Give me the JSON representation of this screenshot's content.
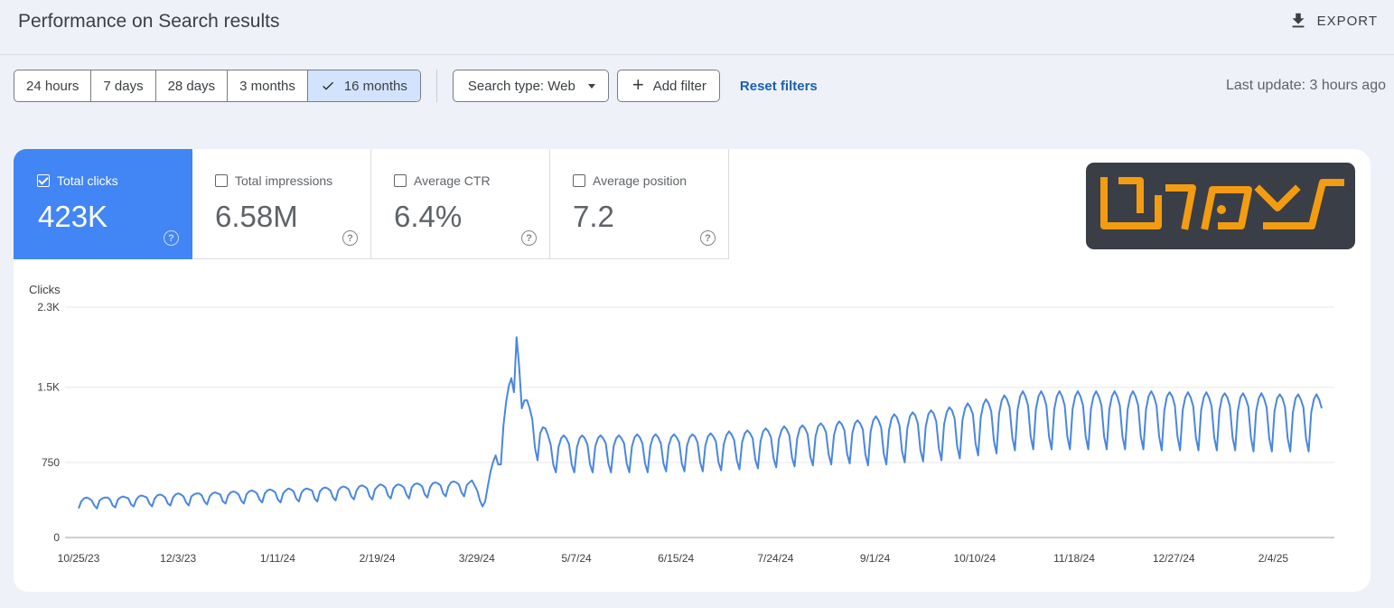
{
  "header": {
    "title": "Performance on Search results",
    "export_label": "EXPORT"
  },
  "toolbar": {
    "ranges": [
      {
        "label": "24 hours",
        "selected": false
      },
      {
        "label": "7 days",
        "selected": false
      },
      {
        "label": "28 days",
        "selected": false
      },
      {
        "label": "3 months",
        "selected": false
      },
      {
        "label": "16 months",
        "selected": true
      }
    ],
    "search_type": "Search type: Web",
    "add_filter": "Add filter",
    "reset": "Reset filters",
    "last_update": "Last update: 3 hours ago"
  },
  "metrics": [
    {
      "label": "Total clicks",
      "value": "423K",
      "checked": true
    },
    {
      "label": "Total impressions",
      "value": "6.58M",
      "checked": false
    },
    {
      "label": "Average CTR",
      "value": "6.4%",
      "checked": false
    },
    {
      "label": "Average position",
      "value": "7.2",
      "checked": false
    }
  ],
  "colors": {
    "accent": "#4285f4",
    "selected_range": "#d3e3fd",
    "link": "#1a5fb4",
    "logo_orange": "#f39c12",
    "logo_bg": "#3a3e46"
  },
  "icons": {
    "export": "download-icon",
    "check": "check-icon",
    "help": "help-circle-icon",
    "add": "plus-icon",
    "dropdown": "caret-down-icon"
  },
  "chart_data": {
    "type": "line",
    "ylabel": "Clicks",
    "yticks": [
      0,
      750,
      1500,
      2300
    ],
    "ytick_labels": [
      "0",
      "750",
      "1.5K",
      "2.3K"
    ],
    "ylim": [
      0,
      2300
    ],
    "grid": true,
    "xtick_labels": [
      "10/25/23",
      "12/3/23",
      "1/11/24",
      "2/19/24",
      "3/29/24",
      "5/7/24",
      "6/15/24",
      "7/24/24",
      "9/1/24",
      "10/10/24",
      "11/18/24",
      "12/27/24",
      "2/4/25"
    ],
    "series": [
      {
        "values": []
      }
    ]
  }
}
